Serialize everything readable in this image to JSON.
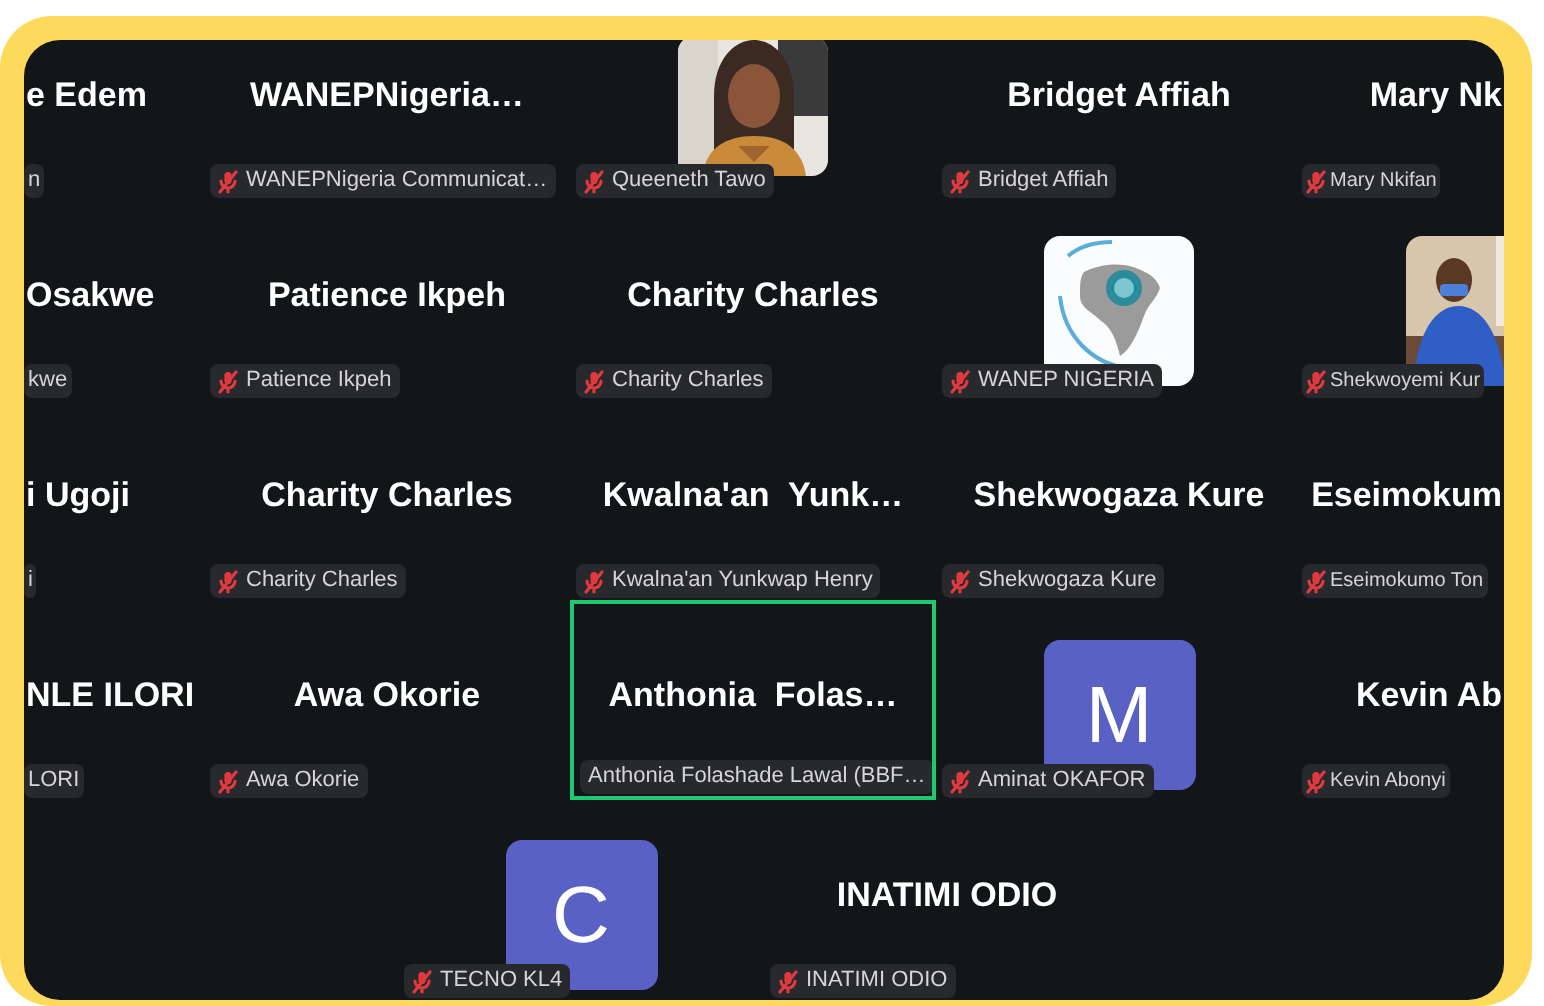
{
  "rows": [
    {
      "tiles": [
        {
          "kind": "name",
          "name": "e Edem",
          "label": "n",
          "muted": false,
          "speaking": false
        },
        {
          "kind": "name",
          "name": "WANEPNigeria…",
          "label": "WANEPNigeria Communicat…",
          "muted": true,
          "speaking": false
        },
        {
          "label": "Queeneth Tawo",
          "muted": true,
          "speaking": false
        },
        {
          "kind": "name",
          "name": "Bridget Affiah",
          "label": "Bridget Affiah",
          "muted": true,
          "speaking": false
        },
        {
          "kind": "name",
          "name": "Mary Nk",
          "label": "Mary Nkifan",
          "muted": true,
          "speaking": false
        }
      ]
    },
    {
      "tiles": [
        {
          "kind": "name",
          "name": "Osakwe",
          "label": "kwe",
          "muted": false,
          "speaking": false
        },
        {
          "kind": "name",
          "name": "Patience Ikpeh",
          "label": "Patience Ikpeh",
          "muted": true,
          "speaking": false
        },
        {
          "kind": "name",
          "name": "Charity Charles",
          "label": "Charity Charles",
          "muted": true,
          "speaking": false
        },
        {
          "kind": "logo",
          "label": "WANEP NIGERIA",
          "muted": true,
          "speaking": false
        },
        {
          "label": "Shekwoyemi Kur",
          "muted": true,
          "speaking": false
        }
      ]
    },
    {
      "tiles": [
        {
          "kind": "name",
          "name": "i Ugoji",
          "label": "i",
          "muted": false,
          "speaking": false
        },
        {
          "kind": "name",
          "name": "Charity Charles",
          "label": "Charity Charles",
          "muted": true,
          "speaking": false
        },
        {
          "kind": "name",
          "name": "Kwalna'an  Yunk…",
          "label": "Kwalna'an Yunkwap Henry",
          "muted": true,
          "speaking": false
        },
        {
          "kind": "name",
          "name": "Shekwogaza Kure",
          "label": "Shekwogaza Kure",
          "muted": true,
          "speaking": false
        },
        {
          "kind": "name",
          "name": "Eseimokum",
          "label": "Eseimokumo Ton",
          "muted": true,
          "speaking": false
        }
      ]
    },
    {
      "tiles": [
        {
          "kind": "name",
          "name": "NLE ILORI",
          "label": "LORI",
          "muted": false,
          "speaking": false
        },
        {
          "kind": "name",
          "name": "Awa Okorie",
          "label": "Awa Okorie",
          "muted": true,
          "speaking": false
        },
        {
          "kind": "name",
          "name": "Anthonia  Folas…",
          "label": "Anthonia Folashade Lawal (BBF…",
          "muted": false,
          "speaking": true
        },
        {
          "kind": "avatar",
          "letter": "M",
          "label": "Aminat OKAFOR",
          "muted": true,
          "speaking": false
        },
        {
          "kind": "name",
          "name": "Kevin Ab",
          "label": "Kevin Abonyi",
          "muted": true,
          "speaking": false
        }
      ]
    },
    {
      "tiles": [
        {
          "kind": "avatar",
          "letter": "C",
          "label": "TECNO KL4",
          "muted": true,
          "speaking": false
        },
        {
          "kind": "name",
          "name": "INATIMI ODIO",
          "label": "INATIMI ODIO",
          "muted": true,
          "speaking": false
        }
      ]
    }
  ]
}
